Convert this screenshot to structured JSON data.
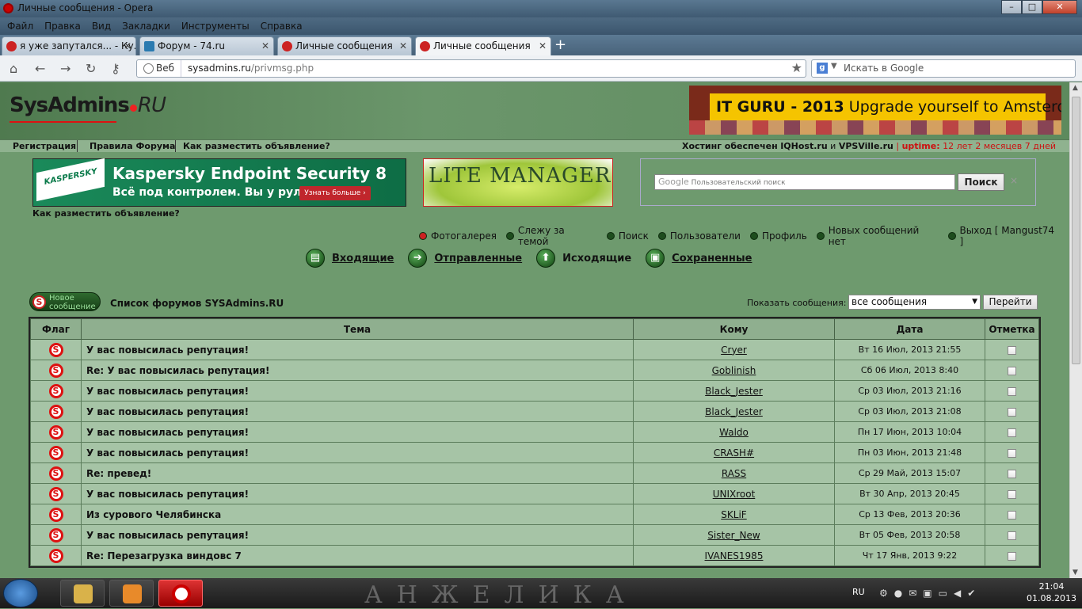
{
  "window": {
    "title": "Личные сообщения - Opera"
  },
  "menu": [
    "Файл",
    "Правка",
    "Вид",
    "Закладки",
    "Инструменты",
    "Справка"
  ],
  "tabs": [
    {
      "label": "я уже запутался... - Ку..."
    },
    {
      "label": "Форум - 74.ru"
    },
    {
      "label": "Личные сообщения"
    },
    {
      "label": "Личные сообщения",
      "active": true
    }
  ],
  "address": {
    "mode": "Веб",
    "host": "sysadmins.ru",
    "path": "/privmsg.php"
  },
  "search": {
    "placeholder": "Искать в Google",
    "engine_icon": "google-icon"
  },
  "site": {
    "logo_main": "SysAdmins",
    "logo_suffix": "RU",
    "banner_bold": "IT GURU - 2013",
    "banner_rest": "Upgrade yourself to Amsterdam!",
    "nav_links": [
      "Регистрация",
      "Правила Форума",
      "Как разместить объявление?"
    ],
    "hosting": {
      "prefix": "Хостинг обеспечен",
      "iqhost": "IQHost.ru",
      "and": "и",
      "vpsville": "VPSVille.ru",
      "sep": "|",
      "uptime_label": "uptime:",
      "uptime_value": "12 лет 2 месяцев 7 дней"
    }
  },
  "ads": {
    "kaspersky": {
      "logo": "KASPERSKY",
      "title": "Kaspersky Endpoint Security 8",
      "subtitle": "Всё под контролем. Вы у руля.",
      "button": "Узнать больше"
    },
    "lite": {
      "title": "LITE MANAGER"
    },
    "google": {
      "google_word": "Google",
      "placeholder": "Пользовательский поиск",
      "button": "Поиск",
      "close": "×"
    },
    "place_link": "Как разместить объявление?"
  },
  "userbar": [
    "Фотогалерея",
    "Слежу за темой",
    "Поиск",
    "Пользователи",
    "Профиль",
    "Новых сообщений нет",
    "Выход [ Mangust74 ]"
  ],
  "folders": [
    {
      "label": "Входящие",
      "link": true
    },
    {
      "label": "Отправленные",
      "link": true
    },
    {
      "label": "Исходящие",
      "link": false
    },
    {
      "label": "Сохраненные",
      "link": true
    }
  ],
  "newmsg": {
    "label": "Новое сообщение"
  },
  "forum_list": "Список форумов SYSAdmins.RU",
  "show_messages": {
    "label": "Показать сообщения:",
    "value": "все сообщения",
    "go": "Перейти"
  },
  "table": {
    "headers": [
      "Флаг",
      "Тема",
      "Кому",
      "Дата",
      "Отметка"
    ],
    "rows": [
      {
        "subject": "У вас повысилась репутация!",
        "to": "Cryer",
        "date": "Вт 16 Июл, 2013 21:55"
      },
      {
        "subject": "Re: У вас повысилась репутация!",
        "to": "Goblinish",
        "date": "Сб 06 Июл, 2013 8:40"
      },
      {
        "subject": "У вас повысилась репутация!",
        "to": "Black_Jester",
        "date": "Ср 03 Июл, 2013 21:16"
      },
      {
        "subject": "У вас повысилась репутация!",
        "to": "Black_Jester",
        "date": "Ср 03 Июл, 2013 21:08"
      },
      {
        "subject": "У вас повысилась репутация!",
        "to": "Waldo",
        "date": "Пн 17 Июн, 2013 10:04"
      },
      {
        "subject": "У вас повысилась репутация!",
        "to": "CRASH#",
        "date": "Пн 03 Июн, 2013 21:48"
      },
      {
        "subject": "Re: превед!",
        "to": "RASS",
        "date": "Ср 29 Май, 2013 15:07"
      },
      {
        "subject": "У вас повысилась репутация!",
        "to": "UNIXroot",
        "date": "Вт 30 Апр, 2013 20:45"
      },
      {
        "subject": "Из сурового Челябинска",
        "to": "SKLiF",
        "date": "Ср 13 Фев, 2013 20:36"
      },
      {
        "subject": "У вас повысилась репутация!",
        "to": "Sister_New",
        "date": "Вт 05 Фев, 2013 20:58"
      },
      {
        "subject": "Re: Перезагрузка виндовс 7",
        "to": "IVANES1985",
        "date": "Чт 17 Янв, 2013 9:22"
      }
    ]
  },
  "taskbar": {
    "wallpaper_text": "АНЖЕЛИКА",
    "lang": "RU",
    "time": "21:04",
    "date": "01.08.2013"
  },
  "colors": {
    "page_bg": "#6e9a6e",
    "table_row": "#a6c4a6",
    "flag_red": "#d11"
  }
}
